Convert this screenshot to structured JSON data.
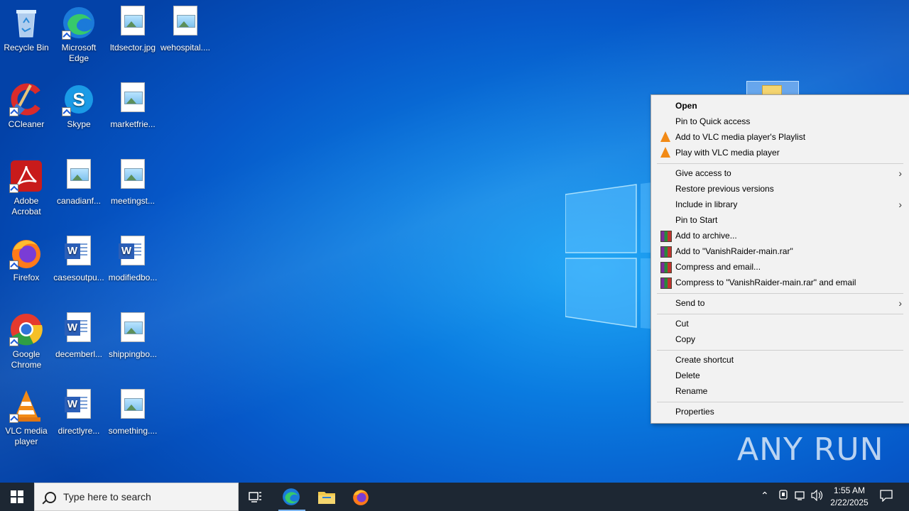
{
  "desktop": {
    "icons": [
      {
        "label": "Recycle Bin",
        "icon": "recycle-bin-icon"
      },
      {
        "label": "Microsoft Edge",
        "icon": "edge-icon"
      },
      {
        "label": "ltdsector.jpg",
        "icon": "image-file-icon"
      },
      {
        "label": "wehospital....",
        "icon": "image-file-icon"
      },
      {
        "label": "CCleaner",
        "icon": "ccleaner-icon"
      },
      {
        "label": "Skype",
        "icon": "skype-icon"
      },
      {
        "label": "marketfrie...",
        "icon": "image-file-icon"
      },
      {
        "label": "Adobe Acrobat",
        "icon": "acrobat-icon"
      },
      {
        "label": "canadianf...",
        "icon": "image-file-icon"
      },
      {
        "label": "meetingst...",
        "icon": "image-file-icon"
      },
      {
        "label": "Firefox",
        "icon": "firefox-icon"
      },
      {
        "label": "casesoutpu...",
        "icon": "word-doc-icon"
      },
      {
        "label": "modifiedbo...",
        "icon": "word-doc-icon"
      },
      {
        "label": "Google Chrome",
        "icon": "chrome-icon"
      },
      {
        "label": "decemberl...",
        "icon": "word-doc-icon"
      },
      {
        "label": "shippingbo...",
        "icon": "image-file-icon"
      },
      {
        "label": "VLC media player",
        "icon": "vlc-icon"
      },
      {
        "label": "directlyre...",
        "icon": "word-doc-icon"
      },
      {
        "label": "something....",
        "icon": "image-file-icon"
      }
    ]
  },
  "context_menu": {
    "items": [
      {
        "label": "Open"
      },
      {
        "label": "Pin to Quick access"
      },
      {
        "label": "Add to VLC media player's Playlist",
        "icon": "vlc-icon"
      },
      {
        "label": "Play with VLC media player",
        "icon": "vlc-icon"
      },
      {
        "label": "Give access to",
        "submenu": true
      },
      {
        "label": "Restore previous versions"
      },
      {
        "label": "Include in library",
        "submenu": true
      },
      {
        "label": "Pin to Start"
      },
      {
        "label": "Add to archive...",
        "icon": "winrar-icon"
      },
      {
        "label": "Add to \"VanishRaider-main.rar\"",
        "icon": "winrar-icon"
      },
      {
        "label": "Compress and email...",
        "icon": "winrar-icon"
      },
      {
        "label": "Compress to \"VanishRaider-main.rar\" and email",
        "icon": "winrar-icon"
      },
      {
        "label": "Send to",
        "submenu": true
      },
      {
        "label": "Cut"
      },
      {
        "label": "Copy"
      },
      {
        "label": "Create shortcut"
      },
      {
        "label": "Delete"
      },
      {
        "label": "Rename"
      },
      {
        "label": "Properties"
      }
    ]
  },
  "taskbar": {
    "search_placeholder": "Type here to search",
    "time": "1:55 AM",
    "date": "2/22/2025"
  },
  "watermark": "ANY RUN"
}
